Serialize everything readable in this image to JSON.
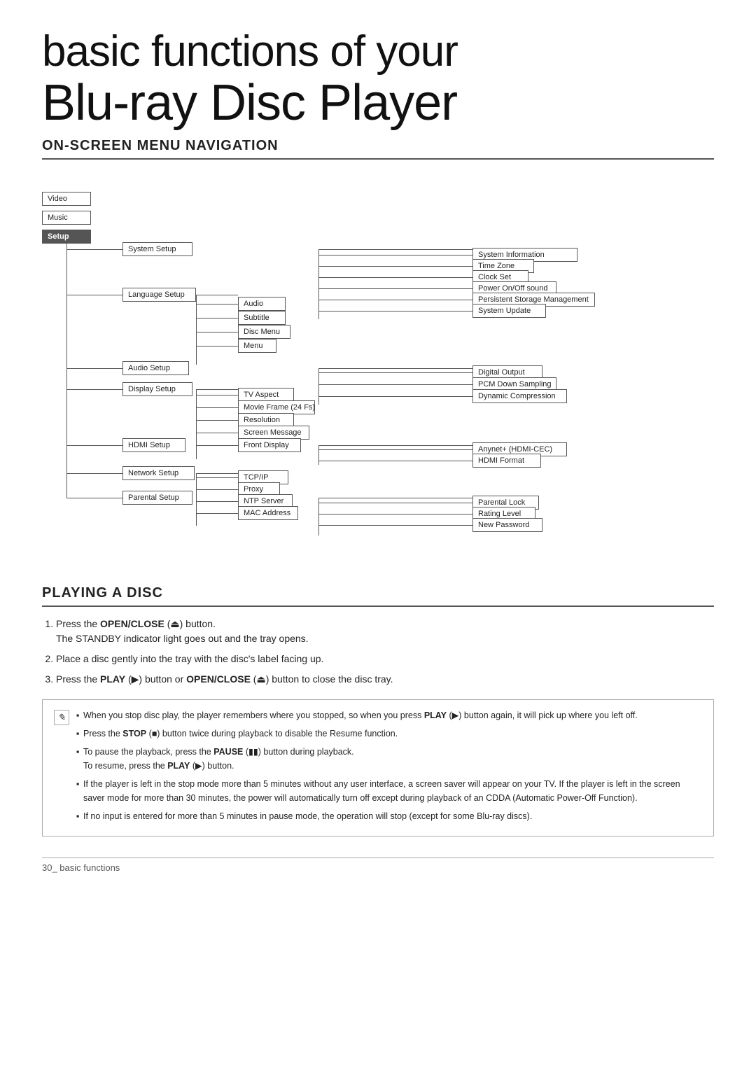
{
  "page": {
    "title_line1": "basic functions of your",
    "title_line2": "Blu-ray Disc Player"
  },
  "sections": {
    "nav": {
      "title": "On-Screen Menu Navigation"
    },
    "playing": {
      "title": "Playing a Disc"
    }
  },
  "menu": {
    "col0": [
      {
        "label": "Video",
        "highlight": false
      },
      {
        "label": "Music",
        "highlight": false
      },
      {
        "label": "Setup",
        "highlight": true
      }
    ],
    "col1": [
      {
        "label": "System Setup"
      },
      {
        "label": "Language Setup"
      },
      {
        "label": "Audio Setup"
      },
      {
        "label": "Display Setup"
      },
      {
        "label": "HDMI Setup"
      },
      {
        "label": "Network Setup"
      },
      {
        "label": "Parental Setup"
      }
    ],
    "col2_lang": [
      {
        "label": "Audio"
      },
      {
        "label": "Subtitle"
      },
      {
        "label": "Disc Menu"
      },
      {
        "label": "Menu"
      }
    ],
    "col2_display": [
      {
        "label": "TV Aspect"
      },
      {
        "label": "Movie Frame (24 Fs)"
      },
      {
        "label": "Resolution"
      },
      {
        "label": "Screen Message"
      },
      {
        "label": "Front Display"
      }
    ],
    "col2_network": [
      {
        "label": "TCP/IP"
      },
      {
        "label": "Proxy"
      },
      {
        "label": "NTP Server"
      },
      {
        "label": "MAC Address"
      }
    ],
    "col3_system": [
      {
        "label": "System Information"
      },
      {
        "label": "Time Zone"
      },
      {
        "label": "Clock Set"
      },
      {
        "label": "Power On/Off sound"
      },
      {
        "label": "Persistent Storage Management"
      },
      {
        "label": "System Update"
      }
    ],
    "col3_audio": [
      {
        "label": "Digital Output"
      },
      {
        "label": "PCM Down Sampling"
      },
      {
        "label": "Dynamic Compression"
      }
    ],
    "col3_hdmi": [
      {
        "label": "Anynet+ (HDMI-CEC)"
      },
      {
        "label": "HDMI Format"
      }
    ],
    "col3_parental": [
      {
        "label": "Parental Lock"
      },
      {
        "label": "Rating Level"
      },
      {
        "label": "New Password"
      }
    ]
  },
  "playing": {
    "steps": [
      {
        "num": "1",
        "text_before": "Press the ",
        "bold1": "OPEN/CLOSE",
        "symbol1": " (⏏) ",
        "text_mid": "button.",
        "sub": "The STANDBY indicator light goes out and the tray opens."
      },
      {
        "num": "2",
        "text": "Place a disc gently into the tray with the disc’s label facing up."
      },
      {
        "num": "3",
        "text_before": "Press the ",
        "bold1": "PLAY",
        "symbol1": " (▶) ",
        "text_mid": "button or ",
        "bold2": "OPEN/CLOSE",
        "symbol2": " (⏏) ",
        "text_end": "button to close the disc tray."
      }
    ],
    "notes": [
      "When you stop disc play, the player remembers where you stopped, so when you press PLAY (▶) button again, it will pick up where you left off.",
      "Press the STOP (■) button twice during playback to disable the Resume function.",
      "To pause the playback, press the PAUSE (⏸) button during playback.\nTo resume, press the PLAY (▶) button.",
      "If the player is left in the stop mode more than 5 minutes without any user interface, a screen saver will appear on your TV. If the player is left in the screen saver mode for more than 30 minutes, the power will automatically turn off except during playback of an CDDA (Automatic Power-Off Function).",
      "If no input is entered for more than 5 minutes in pause mode, the operation will stop (except for some Blu-ray discs)."
    ]
  },
  "footer": {
    "text": "30_ basic functions"
  }
}
